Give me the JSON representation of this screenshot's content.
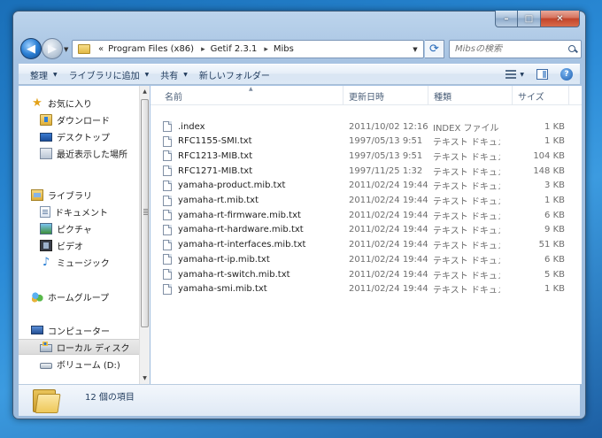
{
  "window": {
    "caption": {
      "minimize": "–",
      "maximize": "□",
      "close": "✕"
    }
  },
  "address": {
    "chevron": "«",
    "crumbs": [
      "Program Files (x86)",
      "Getif 2.3.1",
      "Mibs"
    ],
    "separator": "▸"
  },
  "search": {
    "placeholder": "Mibsの検索"
  },
  "toolbar": {
    "organize": "整理",
    "include_library": "ライブラリに追加",
    "share": "共有",
    "new_folder": "新しいフォルダー"
  },
  "nav": {
    "favorites": "お気に入り",
    "downloads": "ダウンロード",
    "desktop": "デスクトップ",
    "recent": "最近表示した場所",
    "libraries": "ライブラリ",
    "documents": "ドキュメント",
    "pictures": "ピクチャ",
    "videos": "ビデオ",
    "music": "ミュージック",
    "homegroup": "ホームグループ",
    "computer": "コンピューター",
    "local_disk": "ローカル ディスク",
    "volume_d": "ボリューム (D:)"
  },
  "columns": {
    "name": "名前",
    "date": "更新日時",
    "type": "種類",
    "size": "サイズ"
  },
  "files": [
    {
      "name": ".index",
      "date": "2011/10/02 12:16",
      "type": "INDEX ファイル",
      "size": "1 KB"
    },
    {
      "name": "RFC1155-SMI.txt",
      "date": "1997/05/13 9:51",
      "type": "テキスト ドキュメント",
      "size": "1 KB"
    },
    {
      "name": "RFC1213-MIB.txt",
      "date": "1997/05/13 9:51",
      "type": "テキスト ドキュメント",
      "size": "104 KB"
    },
    {
      "name": "RFC1271-MIB.txt",
      "date": "1997/11/25 1:32",
      "type": "テキスト ドキュメント",
      "size": "148 KB"
    },
    {
      "name": "yamaha-product.mib.txt",
      "date": "2011/02/24 19:44",
      "type": "テキスト ドキュメント",
      "size": "3 KB"
    },
    {
      "name": "yamaha-rt.mib.txt",
      "date": "2011/02/24 19:44",
      "type": "テキスト ドキュメント",
      "size": "1 KB"
    },
    {
      "name": "yamaha-rt-firmware.mib.txt",
      "date": "2011/02/24 19:44",
      "type": "テキスト ドキュメント",
      "size": "6 KB"
    },
    {
      "name": "yamaha-rt-hardware.mib.txt",
      "date": "2011/02/24 19:44",
      "type": "テキスト ドキュメント",
      "size": "9 KB"
    },
    {
      "name": "yamaha-rt-interfaces.mib.txt",
      "date": "2011/02/24 19:44",
      "type": "テキスト ドキュメント",
      "size": "51 KB"
    },
    {
      "name": "yamaha-rt-ip.mib.txt",
      "date": "2011/02/24 19:44",
      "type": "テキスト ドキュメント",
      "size": "6 KB"
    },
    {
      "name": "yamaha-rt-switch.mib.txt",
      "date": "2011/02/24 19:44",
      "type": "テキスト ドキュメント",
      "size": "5 KB"
    },
    {
      "name": "yamaha-smi.mib.txt",
      "date": "2011/02/24 19:44",
      "type": "テキスト ドキュメント",
      "size": "1 KB"
    }
  ],
  "details": {
    "item_count": "12 個の項目"
  }
}
